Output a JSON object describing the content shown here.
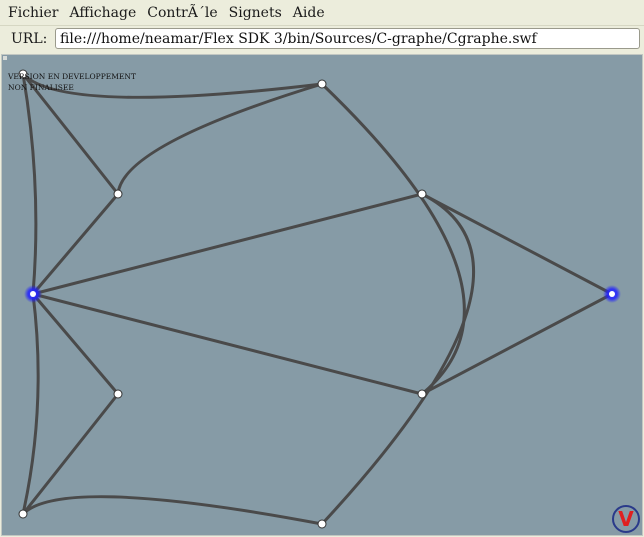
{
  "menu": {
    "items": [
      {
        "id": "fichier",
        "label": "Fichier"
      },
      {
        "id": "affichage",
        "label": "Affichage"
      },
      {
        "id": "controle",
        "label": "ContrÃ´le"
      },
      {
        "id": "signets",
        "label": "Signets"
      },
      {
        "id": "aide",
        "label": "Aide"
      }
    ]
  },
  "urlbar": {
    "label": "URL:",
    "value": "file:///home/neamar/Flex SDK 3/bin/Sources/C-graphe/Cgraphe.swf"
  },
  "flash": {
    "notice_line1": "VERSION EN DEVELOPPEMENT",
    "notice_line2": "NON FINALISEE",
    "logo_letter": "V",
    "colors": {
      "background": "#869ba6",
      "edge": "#4a4a4a",
      "node_fill": "#ffffff",
      "selected_node": "#1a1aff",
      "logo_ring": "#2a3a8a",
      "logo_letter": "#e02020"
    },
    "graph": {
      "nodes": [
        {
          "id": "n-top-left",
          "selected": false
        },
        {
          "id": "n-top-mid",
          "selected": false
        },
        {
          "id": "n-upper-inner",
          "selected": false
        },
        {
          "id": "n-upper-right",
          "selected": false
        },
        {
          "id": "n-left-hub",
          "selected": true
        },
        {
          "id": "n-far-right",
          "selected": true
        },
        {
          "id": "n-lower-inner",
          "selected": false
        },
        {
          "id": "n-lower-right",
          "selected": false
        },
        {
          "id": "n-bottom-left",
          "selected": false
        },
        {
          "id": "n-bottom-mid",
          "selected": false
        }
      ]
    }
  }
}
